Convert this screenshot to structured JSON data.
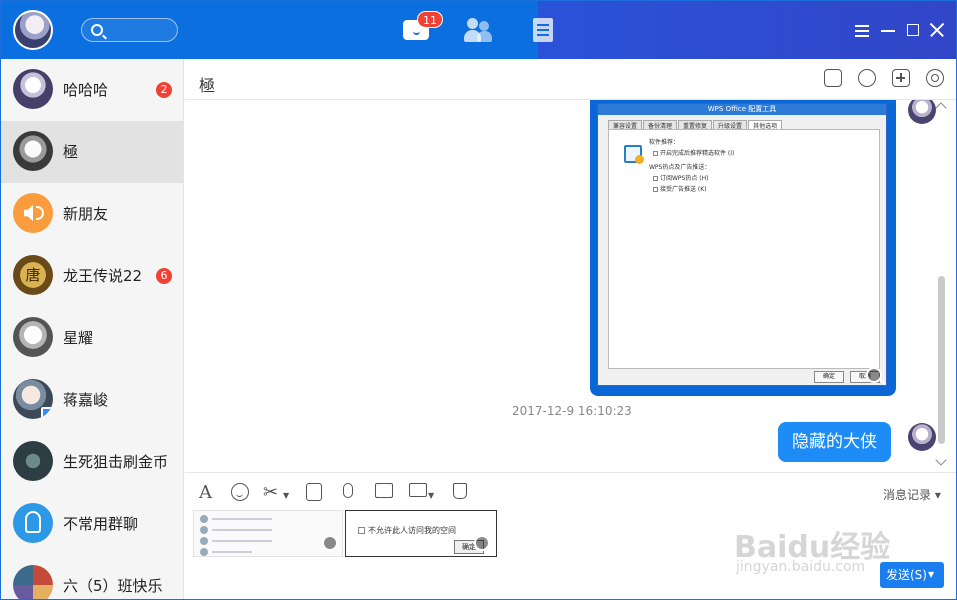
{
  "topbar": {
    "msg_badge": "11"
  },
  "conversations": [
    {
      "name": "哈哈哈",
      "badge": "2"
    },
    {
      "name": "極",
      "badge": ""
    },
    {
      "name": "新朋友",
      "badge": ""
    },
    {
      "name": "龙王传说22",
      "badge": "6",
      "avatar_text": "唐"
    },
    {
      "name": "星耀",
      "badge": ""
    },
    {
      "name": "蒋嘉峻",
      "badge": ""
    },
    {
      "name": "生死狙击刷金币",
      "badge": ""
    },
    {
      "name": "不常用群聊",
      "badge": ""
    },
    {
      "name": "六（5）班快乐",
      "badge": ""
    }
  ],
  "chat": {
    "title": "極",
    "timestamp": "2017-12-9 16:10:23",
    "last_message": "隐藏的大侠",
    "screenshot": {
      "window_title": "WPS Office 配置工具",
      "tabs": [
        "兼容设置",
        "备份清理",
        "重置修复",
        "升级设置",
        "其他选项"
      ],
      "section1": "软件推荐：",
      "option1": "开启完成后推荐精选软件 (I)",
      "section2": "WPS热点及广告推送：",
      "option2": "订阅WPS热点 (H)",
      "option3": "接受广告推送 (K)",
      "ok": "确定",
      "cancel": "取消"
    }
  },
  "toolbar": {
    "history": "消息记录"
  },
  "input": {
    "thumb2_text": "不允许此人访问我的空间",
    "thumb2_ok": "确定",
    "send_label": "发送(S)"
  },
  "watermark": {
    "brand": "Baidu经验",
    "url": "jingyan.baidu.com"
  }
}
